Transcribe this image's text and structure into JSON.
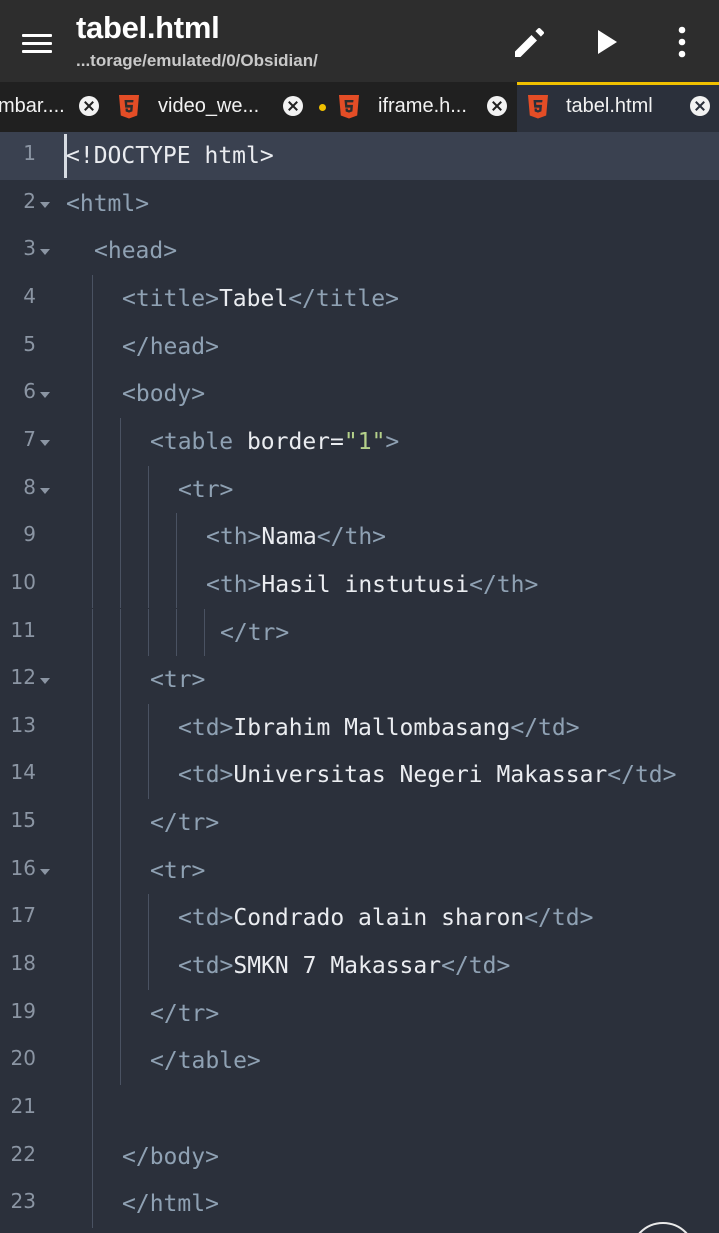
{
  "app": {
    "title": "tabel.html",
    "path": "...torage/emulated/0/Obsidian/",
    "actions": {
      "menu": "menu-icon",
      "edit": "pencil-icon",
      "run": "play-icon",
      "more": "more-vert-icon"
    }
  },
  "tabs": [
    {
      "label": "mbar...."
    },
    {
      "label": "video_we..."
    },
    {
      "label": "iframe.h..."
    },
    {
      "label": "tabel.html"
    }
  ],
  "colors": {
    "accent": "#f0c000",
    "tag": "#8fa1b3",
    "string": "#b5d18a",
    "text": "#eaecf0",
    "editor_bg": "#2b303b",
    "html5_icon": "#e44d26"
  },
  "editor": {
    "lines": [
      {
        "num": "1",
        "parts": [
          {
            "text": "<!DOCTYPE html>",
            "c": ""
          }
        ]
      },
      {
        "num": "2",
        "parts": [
          {
            "text": "<html>",
            "c": "t"
          }
        ]
      },
      {
        "num": "3",
        "parts": [
          {
            "text": "<head>",
            "c": "t"
          }
        ]
      },
      {
        "num": "4",
        "parts": [
          {
            "text": "<title>",
            "c": "t"
          },
          {
            "text": "Tabel",
            "c": ""
          },
          {
            "text": "</title>",
            "c": "t"
          }
        ]
      },
      {
        "num": "5",
        "parts": [
          {
            "text": "</head>",
            "c": "t"
          }
        ]
      },
      {
        "num": "6",
        "parts": [
          {
            "text": "<body>",
            "c": "t"
          }
        ]
      },
      {
        "num": "7",
        "parts": [
          {
            "text": "<table ",
            "c": "t"
          },
          {
            "text": "border=",
            "c": ""
          },
          {
            "text": "\"1\"",
            "c": "s"
          },
          {
            "text": ">",
            "c": "t"
          }
        ]
      },
      {
        "num": "8",
        "parts": [
          {
            "text": "<tr>",
            "c": "t"
          }
        ]
      },
      {
        "num": "9",
        "parts": [
          {
            "text": "<th>",
            "c": "t"
          },
          {
            "text": "Nama",
            "c": ""
          },
          {
            "text": "</th>",
            "c": "t"
          }
        ]
      },
      {
        "num": "10",
        "parts": [
          {
            "text": "<th>",
            "c": "t"
          },
          {
            "text": "Hasil instutusi",
            "c": ""
          },
          {
            "text": "</th>",
            "c": "t"
          }
        ]
      },
      {
        "num": "11",
        "parts": [
          {
            "text": "</tr>",
            "c": "t"
          }
        ]
      },
      {
        "num": "12",
        "parts": [
          {
            "text": "<tr>",
            "c": "t"
          }
        ]
      },
      {
        "num": "13",
        "parts": [
          {
            "text": "<td>",
            "c": "t"
          },
          {
            "text": "Ibrahim Mallombasang",
            "c": ""
          },
          {
            "text": "</td>",
            "c": "t"
          }
        ]
      },
      {
        "num": "14",
        "parts": [
          {
            "text": "<td>",
            "c": "t"
          },
          {
            "text": "Universitas Negeri Makassar",
            "c": ""
          },
          {
            "text": "</td>",
            "c": "t"
          }
        ]
      },
      {
        "num": "15",
        "parts": [
          {
            "text": "</tr>",
            "c": "t"
          }
        ]
      },
      {
        "num": "16",
        "parts": [
          {
            "text": "<tr>",
            "c": "t"
          }
        ]
      },
      {
        "num": "17",
        "parts": [
          {
            "text": "<td>",
            "c": "t"
          },
          {
            "text": "Condrado alain sharon",
            "c": ""
          },
          {
            "text": "</td>",
            "c": "t"
          }
        ]
      },
      {
        "num": "18",
        "parts": [
          {
            "text": "<td>",
            "c": "t"
          },
          {
            "text": "SMKN 7 Makassar",
            "c": ""
          },
          {
            "text": "</td>",
            "c": "t"
          }
        ]
      },
      {
        "num": "19",
        "parts": [
          {
            "text": "</tr>",
            "c": "t"
          }
        ]
      },
      {
        "num": "20",
        "parts": [
          {
            "text": "</table>",
            "c": "t"
          }
        ]
      },
      {
        "num": "21",
        "parts": []
      },
      {
        "num": "22",
        "parts": [
          {
            "text": "</body>",
            "c": "t"
          }
        ]
      },
      {
        "num": "23",
        "parts": [
          {
            "text": "</html>",
            "c": "t"
          }
        ]
      }
    ]
  }
}
